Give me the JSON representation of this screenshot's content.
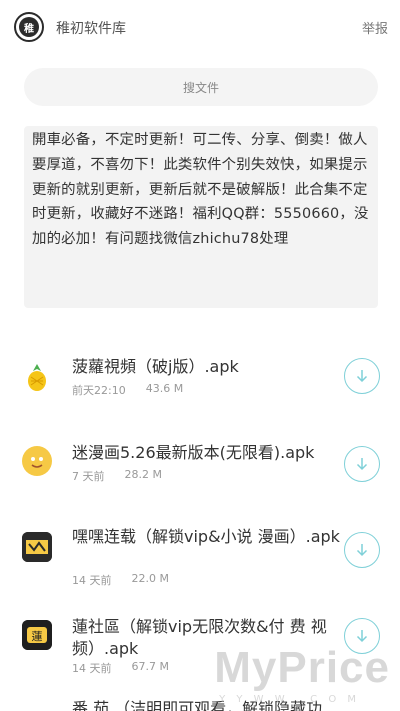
{
  "header": {
    "app_title": "稚初软件库",
    "report_label": "举报",
    "logo_text": "稚"
  },
  "search": {
    "placeholder": "搜文件"
  },
  "notice": {
    "text": "開車必备，不定时更新！可二传、分享、倒卖！做人要厚道，不喜勿下！此类软件个别失效快，如果提示更新的就别更新，更新后就不是破解版！此合集不定时更新，收藏好不迷路！福利QQ群：5550660，没加的必加！有问题找微信zhichu78处理"
  },
  "files": [
    {
      "name": "菠蘿視頻（破j版）.apk",
      "time": "前天22:10",
      "size": "43.6 M",
      "icon": "pineapple-icon",
      "icon_color": "#f5c518"
    },
    {
      "name": "迷漫画5.26最新版本(无限看).apk",
      "time": "7 天前",
      "size": "28.2 M",
      "icon": "cartoon-face-icon",
      "icon_color": "#f6c945"
    },
    {
      "name": "嘿嘿连载（解锁vip&小说 漫画）.apk",
      "time": "14 天前",
      "size": "22.0 M",
      "icon": "comic-cover-icon",
      "icon_color": "#2a2a2a"
    },
    {
      "name": "蓮社區（解锁vip无限次数&付 费 视频）.apk",
      "time": "14 天前",
      "size": "67.7 M",
      "icon": "lotus-community-icon",
      "icon_color": "#1f1f1f"
    },
    {
      "name": "番 茄 （洁明即可观看，解锁隐藏功",
      "time": "",
      "size": "",
      "icon": "app-icon",
      "icon_color": "#f08a24"
    }
  ],
  "watermark": {
    "text": "MyPrice",
    "sub": "Y Y W W . C O M"
  },
  "colors": {
    "accent": "#7fd0d8",
    "notice_bg": "#f3f3f3",
    "meta_text": "#999999"
  }
}
